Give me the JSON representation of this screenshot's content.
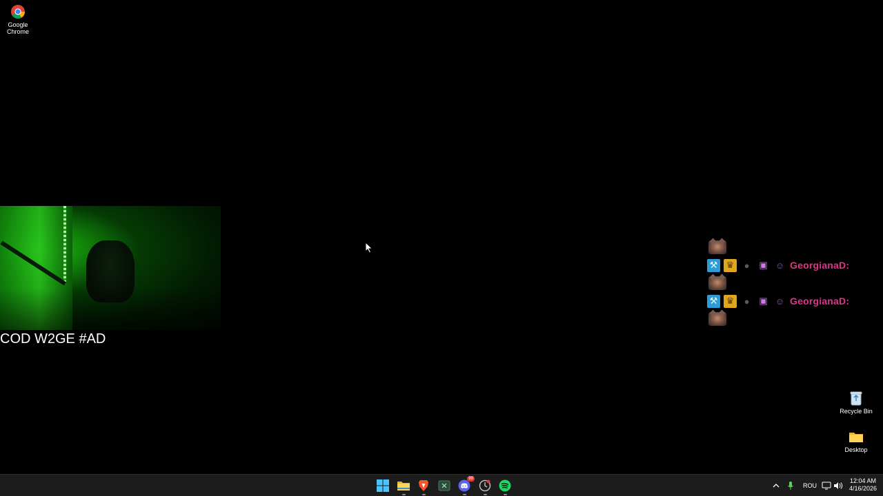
{
  "desktop": {
    "icons": [
      {
        "name": "chrome",
        "label": "Google Chrome"
      },
      {
        "name": "recycle-bin",
        "label": "Recycle Bin"
      },
      {
        "name": "desktop-folder",
        "label": "Desktop"
      }
    ]
  },
  "overlay": {
    "stream_title": "COD W2GE #AD",
    "chat": {
      "username": "GeorgianaD:",
      "username_color": "#e0348a",
      "badges": [
        "mod-hammer-icon",
        "vip-crown-icon",
        "drop-icon",
        "gift-icon",
        "sub-cat-icon"
      ]
    }
  },
  "taskbar": {
    "apps": [
      "windows-start-icon",
      "file-explorer-icon",
      "brave-icon",
      "xbox-icon",
      "discord-icon",
      "app-icon",
      "spotify-icon"
    ],
    "discord_badge": "99",
    "tray": {
      "language": "ROU",
      "time": "12:04 AM",
      "date": "4/16/2026"
    }
  },
  "colors": {
    "background": "#000000",
    "taskbar": "#1c1c1c",
    "accent_green": "#29c41c"
  }
}
